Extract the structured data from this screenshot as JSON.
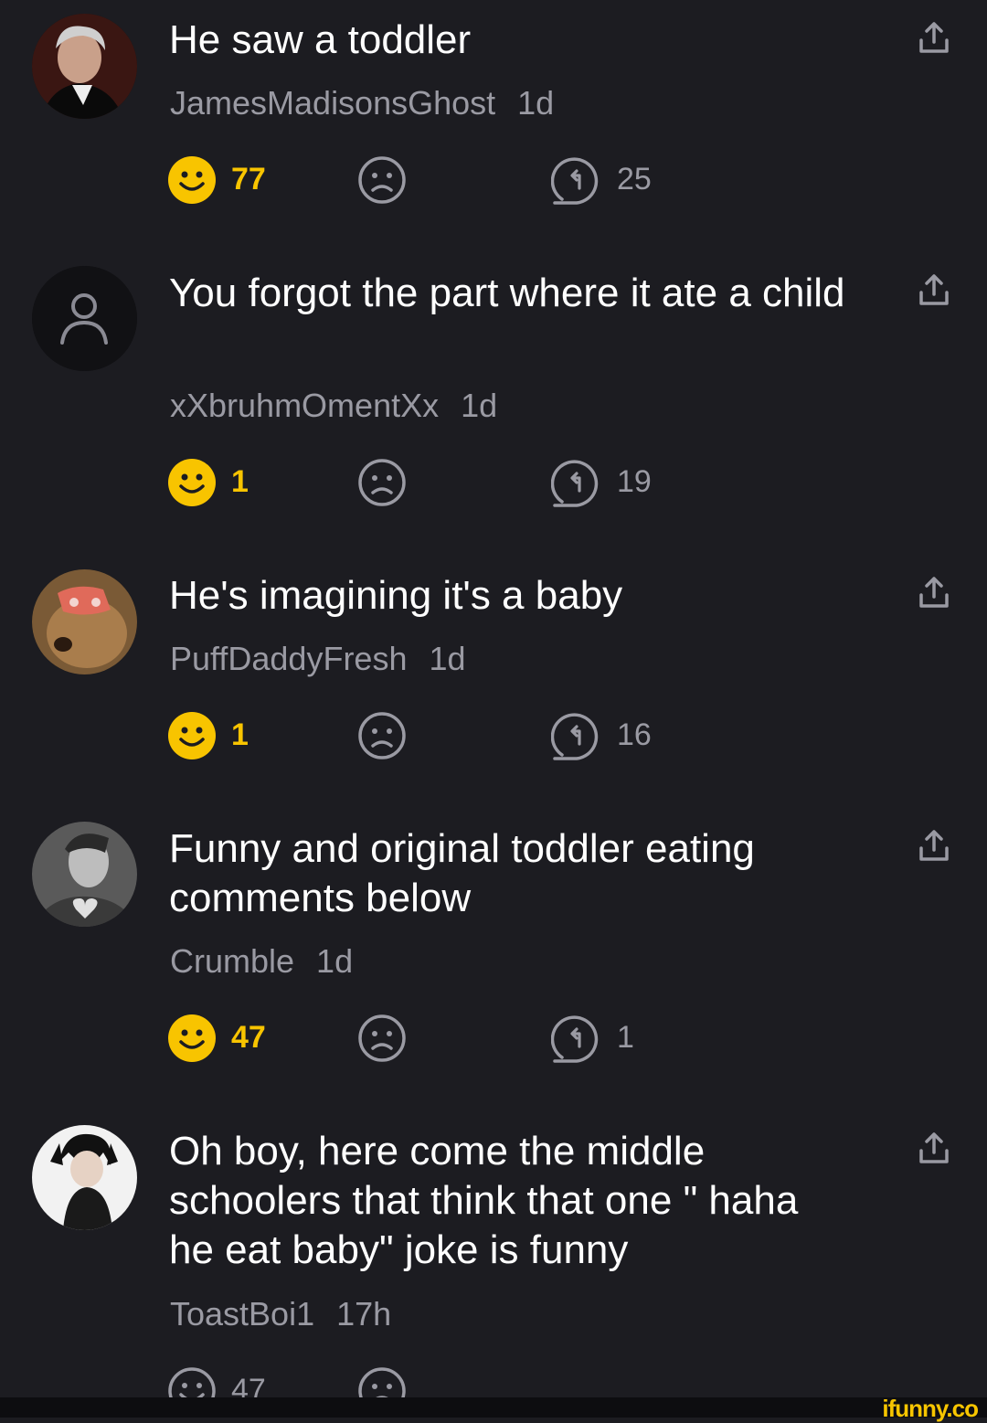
{
  "comments": [
    {
      "text": "He saw a toddler",
      "user": "JamesMadisonsGhost",
      "time": "1d",
      "smiles": "77",
      "replies": "25"
    },
    {
      "text": "You forgot the part where it ate a child",
      "user": "xXbruhmOmentXx",
      "time": "1d",
      "smiles": "1",
      "replies": "19"
    },
    {
      "text": "He's imagining it's a baby",
      "user": "PuffDaddyFresh",
      "time": "1d",
      "smiles": "1",
      "replies": "16"
    },
    {
      "text": "Funny and original toddler eating comments below",
      "user": "Crumble",
      "time": "1d",
      "smiles": "47",
      "replies": "1"
    },
    {
      "text": "Oh boy, here come the middle schoolers that think that one \" haha he eat baby\" joke is funny",
      "user": "ToastBoi1",
      "time": "17h",
      "smiles": "47"
    }
  ],
  "colors": {
    "background": "#1c1c21",
    "smile": "#f8c400",
    "muted": "#9a9aa3",
    "text": "#ffffff"
  },
  "icons": {
    "smile": "smile-icon",
    "unsmile": "unsmile-icon",
    "reply": "reply-icon",
    "share": "share-icon"
  },
  "watermark": "ifunny.co"
}
